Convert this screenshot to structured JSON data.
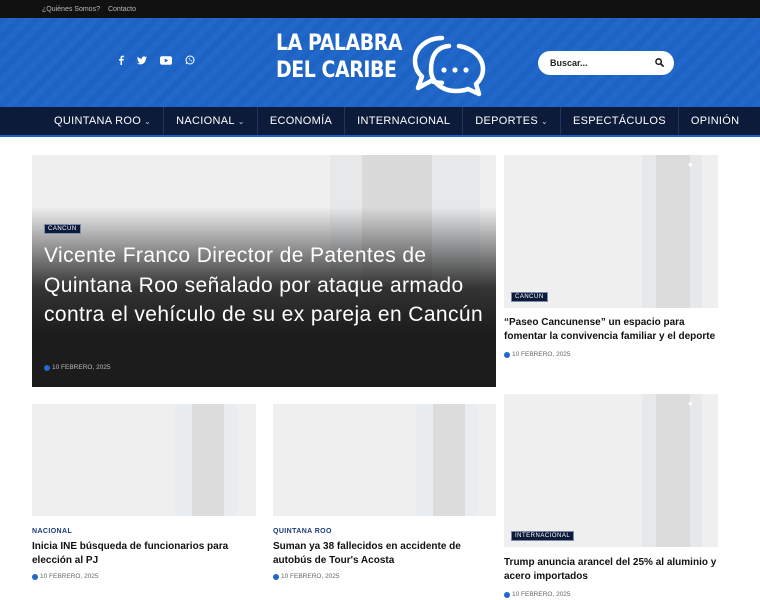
{
  "topbar": {
    "links": [
      "¿Quiénes Somos?",
      "Contacto"
    ]
  },
  "header": {
    "logo_line1": "LA PALABRA",
    "logo_line2": "DEL CARIBE",
    "search_placeholder": "Buscar...",
    "social": [
      "facebook-icon",
      "twitter-icon",
      "youtube-icon",
      "whatsapp-icon"
    ]
  },
  "nav": {
    "items": [
      {
        "label": "QUINTANA ROO",
        "has_dropdown": true
      },
      {
        "label": "NACIONAL",
        "has_dropdown": true
      },
      {
        "label": "ECONOMÍA",
        "has_dropdown": false
      },
      {
        "label": "INTERNACIONAL",
        "has_dropdown": false
      },
      {
        "label": "DEPORTES",
        "has_dropdown": true
      },
      {
        "label": "ESPECTÁCULOS",
        "has_dropdown": false
      },
      {
        "label": "OPINIÓN",
        "has_dropdown": false
      }
    ]
  },
  "hero": {
    "category": "CANCÚN",
    "title": "Vicente Franco Director de Patentes de Quintana Roo señalado por ataque armado contra el vehículo de su ex pareja en Cancún",
    "date": "10 FEBRERO, 2025"
  },
  "side_top": {
    "category": "CANCÚN",
    "title": "“Paseo Cancunense” un espacio para fomentar la convivencia familiar y el deporte",
    "date": "10 FEBRERO, 2025"
  },
  "card_left": {
    "category": "NACIONAL",
    "title": "Inicia INE búsqueda de funcionarios para elección al PJ",
    "date": "10 FEBRERO, 2025"
  },
  "card_mid": {
    "category": "QUINTANA ROO",
    "title": "Suman ya 38 fallecidos en accidente de autobús de Tour's Acosta",
    "date": "10 FEBRERO, 2025"
  },
  "side_bottom": {
    "category": "INTERNACIONAL",
    "title": "Trump anuncia arancel del 25% al aluminio y acero importados",
    "date": "10 FEBRERO, 2025"
  },
  "colors": {
    "header_blue": "#1e63c4",
    "nav_bg": "#0d1b3a",
    "accent": "#2068c9"
  }
}
